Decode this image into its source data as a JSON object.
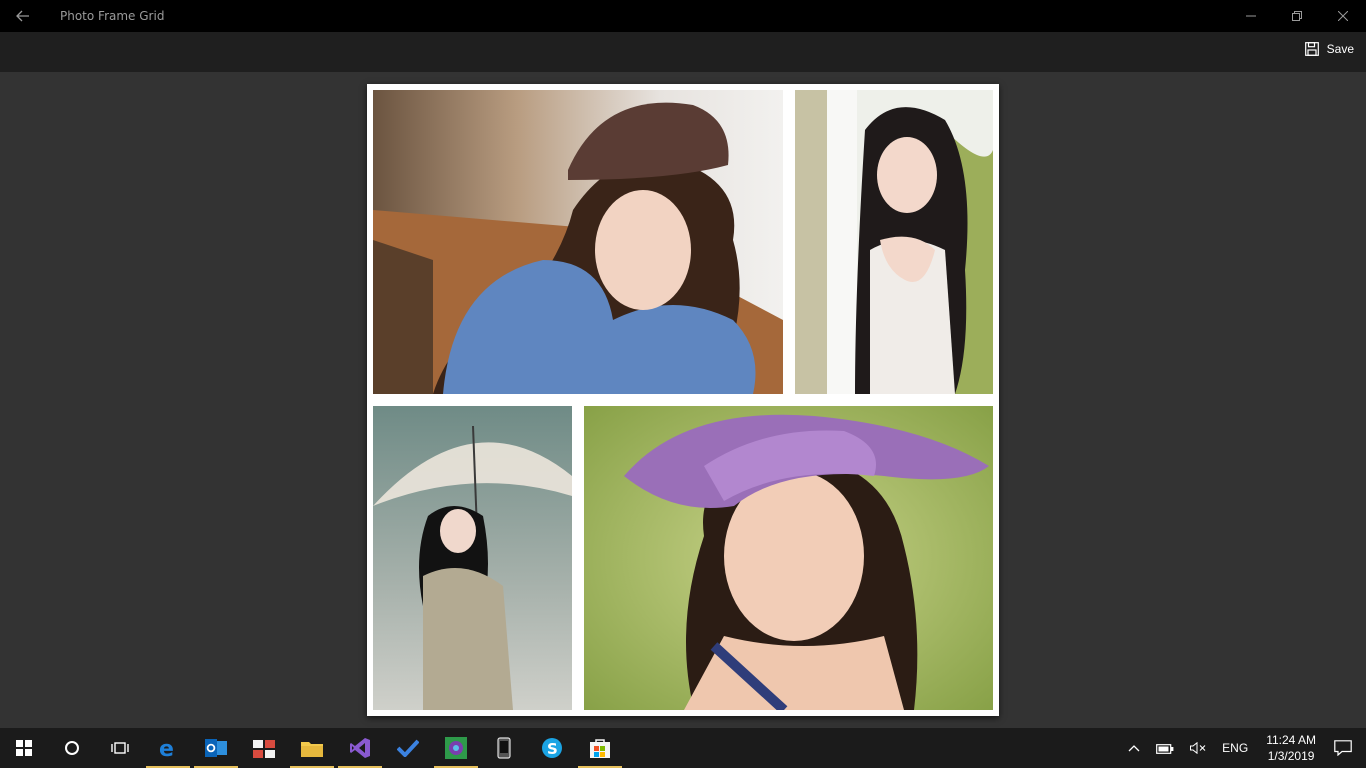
{
  "window": {
    "title": "Photo Frame Grid",
    "controls": [
      "minimize-icon",
      "restore-icon",
      "close-icon"
    ]
  },
  "appbar": {
    "save_label": "Save",
    "save_icon": "floppy-disk-icon"
  },
  "collage": {
    "frame_color": "#ffffff",
    "photos": [
      {
        "id": "photo-top-left",
        "description_icon": "woman-knit-hat-blue-coat"
      },
      {
        "id": "photo-top-right",
        "description_icon": "woman-by-window"
      },
      {
        "id": "photo-bottom-left",
        "description_icon": "woman-with-umbrella"
      },
      {
        "id": "photo-bottom-right",
        "description_icon": "woman-purple-sun-hat"
      }
    ]
  },
  "taskbar": {
    "apps": [
      {
        "name": "start-icon"
      },
      {
        "name": "cortana-icon"
      },
      {
        "name": "task-view-icon"
      },
      {
        "name": "edge-icon",
        "active": true
      },
      {
        "name": "outlook-icon",
        "active": true
      },
      {
        "name": "calculator-tiles-icon"
      },
      {
        "name": "file-explorer-icon",
        "active": true
      },
      {
        "name": "visual-studio-icon",
        "active": true
      },
      {
        "name": "todo-check-icon"
      },
      {
        "name": "photo-frame-app-icon",
        "active": true
      },
      {
        "name": "phone-icon"
      },
      {
        "name": "skype-icon"
      },
      {
        "name": "store-icon",
        "active": true
      }
    ],
    "tray": {
      "language": "ENG",
      "time": "11:24 AM",
      "date": "1/3/2019"
    }
  },
  "colors": {
    "titlebar": "#000000",
    "appbar": "#1f1f1f",
    "canvas": "#333333",
    "taskbar": "#1b1b1b",
    "active_indicator": "#e6c05c"
  }
}
